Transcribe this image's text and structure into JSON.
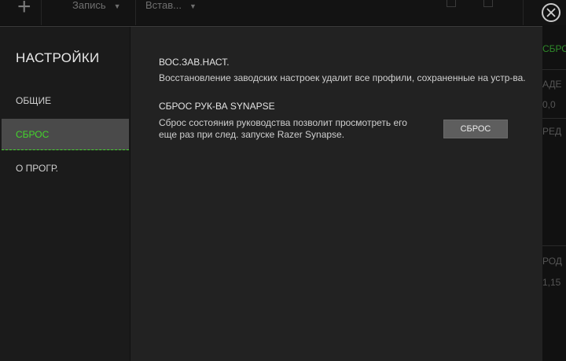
{
  "background": {
    "toolbar_menus": [
      {
        "label": "Запись"
      },
      {
        "label": "Встав..."
      }
    ],
    "right_fragments": [
      "СБРО",
      "АДЕ",
      "0,0",
      "РЕД",
      "РОД",
      "1,15"
    ]
  },
  "sidebar": {
    "title": "НАСТРОЙКИ",
    "items": [
      {
        "label": "ОБЩИЕ",
        "active": false
      },
      {
        "label": "СБРОС",
        "active": true
      },
      {
        "label": "О ПРОГР.",
        "active": false
      }
    ]
  },
  "main": {
    "sections": [
      {
        "title": "ВОС.ЗАВ.НАСТ.",
        "text": "Восстановление заводских настроек удалит все профили, сохраненные на устр-ва."
      },
      {
        "title": "СБРОС РУК-ВА SYNAPSE",
        "text_line1": "Сброс состояния руководства позволит просмотреть его",
        "text_line2": "еще раз при след. запуске Razer Synapse.",
        "button_label": "СБРОС"
      }
    ]
  },
  "colors": {
    "accent": "#44d62c",
    "dialog_bg": "#222222",
    "sidebar_bg": "#1b1b1b",
    "active_item_bg": "#4a4a4a"
  },
  "icons": {
    "close": "close-icon",
    "add": "plus-icon",
    "dropdown": "chevron-down-icon"
  }
}
